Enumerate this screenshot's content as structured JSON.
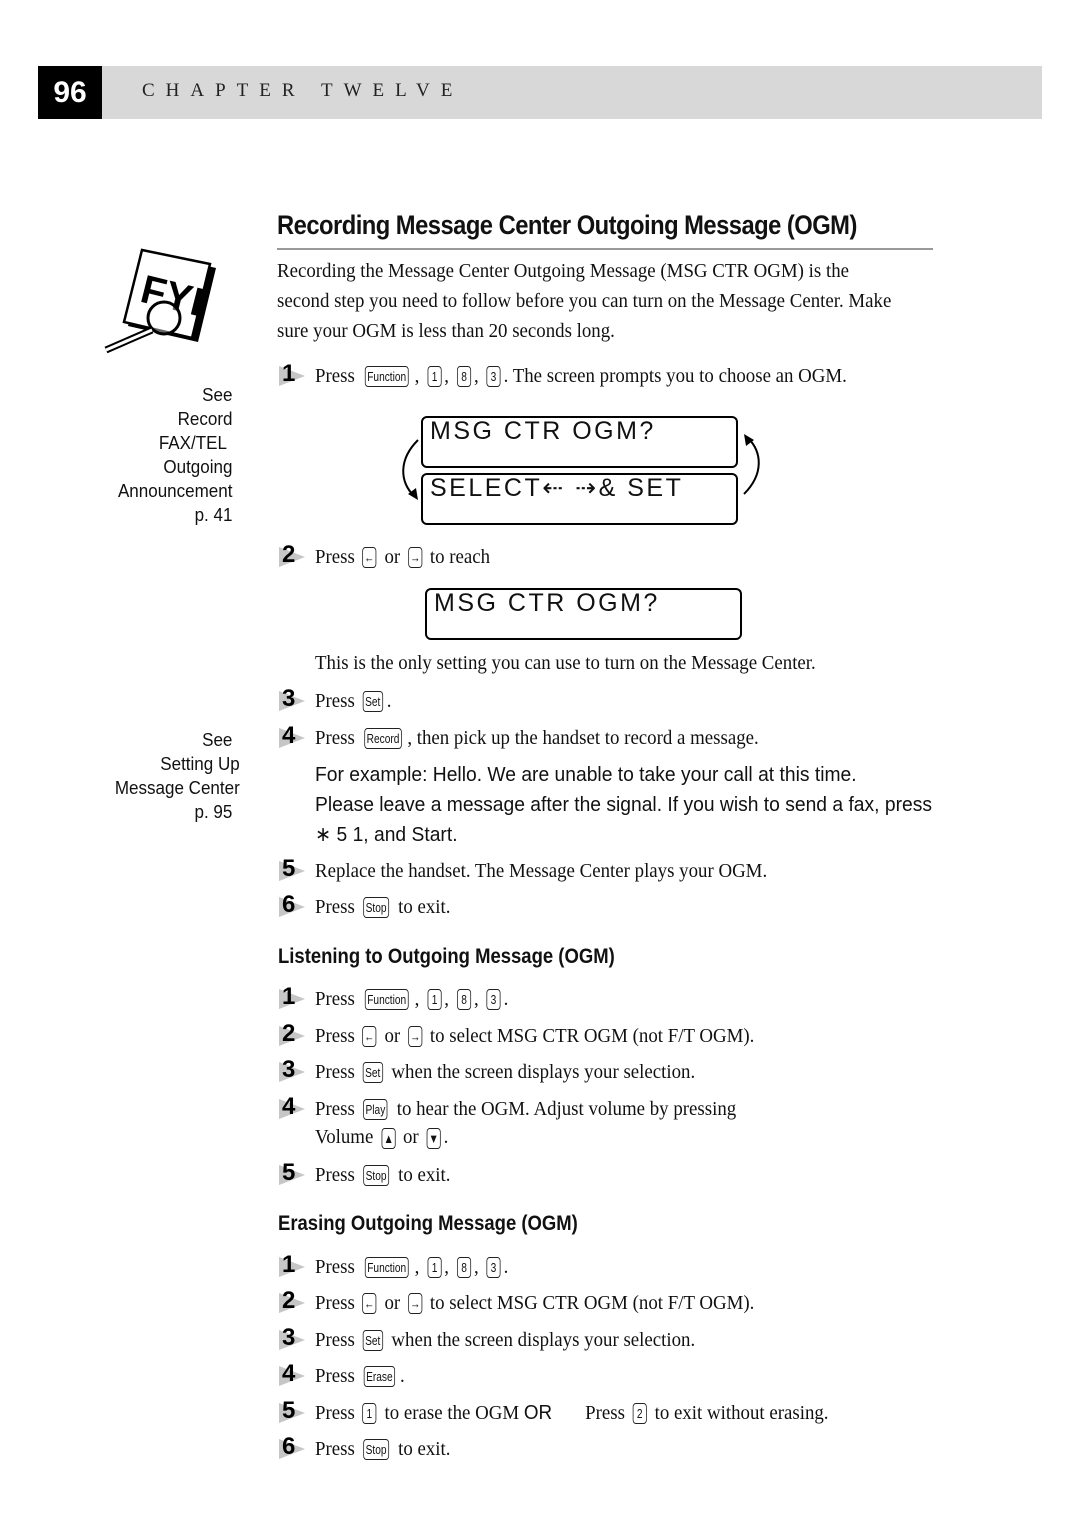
{
  "header": {
    "page_number": "96",
    "chapter": "CHAPTER TWELVE"
  },
  "title": "Recording Message Center Outgoing Message (OGM)",
  "intro": "Recording the Message Center Outgoing Message (MSG CTR OGM) is the second step you need to follow before you can turn on the Message Center. Make sure your OGM is less than 20 seconds long.",
  "fyi_icon": "FYI",
  "side_notes": [
    {
      "lines": [
        "See",
        "Record",
        "FAX/TEL",
        "Outgoing",
        "Announcement",
        "p. 41"
      ]
    },
    {
      "lines": [
        "See",
        "Setting Up",
        "Message Center",
        "p. 95"
      ]
    }
  ],
  "keys": {
    "function": "Function",
    "one": "1",
    "two": "2",
    "eight": "8",
    "three": "3",
    "set": "Set",
    "record": "Record",
    "stop": "Stop",
    "play": "Play",
    "erase": "Erase",
    "left": "←",
    "right": "→",
    "up": "▲",
    "down": "▼"
  },
  "recording": {
    "step1": {
      "num": "1",
      "press": "Press",
      "after": ". The screen prompts you to choose an OGM."
    },
    "lcd1": {
      "line1": "MSG CTR OGM?",
      "line2": "SELECT⇠  ⇢& SET"
    },
    "step2": {
      "num": "2",
      "press": "Press",
      "or": "or",
      "after": "to reach"
    },
    "lcd2": "MSG CTR OGM?",
    "note": "This is the only setting you can use to turn on the Message Center.",
    "step3": {
      "num": "3",
      "press": "Press",
      "after": "."
    },
    "step4": {
      "num": "4",
      "press": "Press",
      "after": ", then pick up the handset to record a message."
    },
    "example": [
      "For example: Hello. We are unable to take your call at this time.",
      "Please leave a message after the signal. If you wish to send a fax, press",
      "∗ 5 1, and Start."
    ],
    "step5": {
      "num": "5",
      "text": "Replace the handset. The Message Center plays your OGM."
    },
    "step6": {
      "num": "6",
      "press": "Press",
      "after": "to exit."
    }
  },
  "listening": {
    "heading": "Listening to Outgoing Message (OGM)",
    "step1": {
      "num": "1",
      "press": "Press",
      "after": "."
    },
    "step2": {
      "num": "2",
      "press": "Press",
      "or": "or",
      "after": "to select MSG CTR OGM (not F/T OGM)."
    },
    "step3": {
      "num": "3",
      "press": "Press",
      "after": "when the screen displays your selection."
    },
    "step4": {
      "num": "4",
      "press": "Press",
      "after": "to hear the OGM. Adjust volume by pressing",
      "line2_pre": "Volume",
      "or": "or",
      "line2_post": "."
    },
    "step5": {
      "num": "5",
      "press": "Press",
      "after": "to exit."
    }
  },
  "erasing": {
    "heading": "Erasing Outgoing Message (OGM)",
    "step1": {
      "num": "1",
      "press": "Press",
      "after": "."
    },
    "step2": {
      "num": "2",
      "press": "Press",
      "or": "or",
      "after": "to select MSG CTR OGM (not F/T OGM)."
    },
    "step3": {
      "num": "3",
      "press": "Press",
      "after": "when the screen displays your selection."
    },
    "step4": {
      "num": "4",
      "press": "Press",
      "after": "."
    },
    "step5": {
      "num": "5",
      "press": "Press",
      "mid": "to erase the OGM",
      "or_word": "OR",
      "press2": "Press",
      "after": "to exit without erasing."
    },
    "step6": {
      "num": "6",
      "press": "Press",
      "after": "to exit."
    }
  }
}
